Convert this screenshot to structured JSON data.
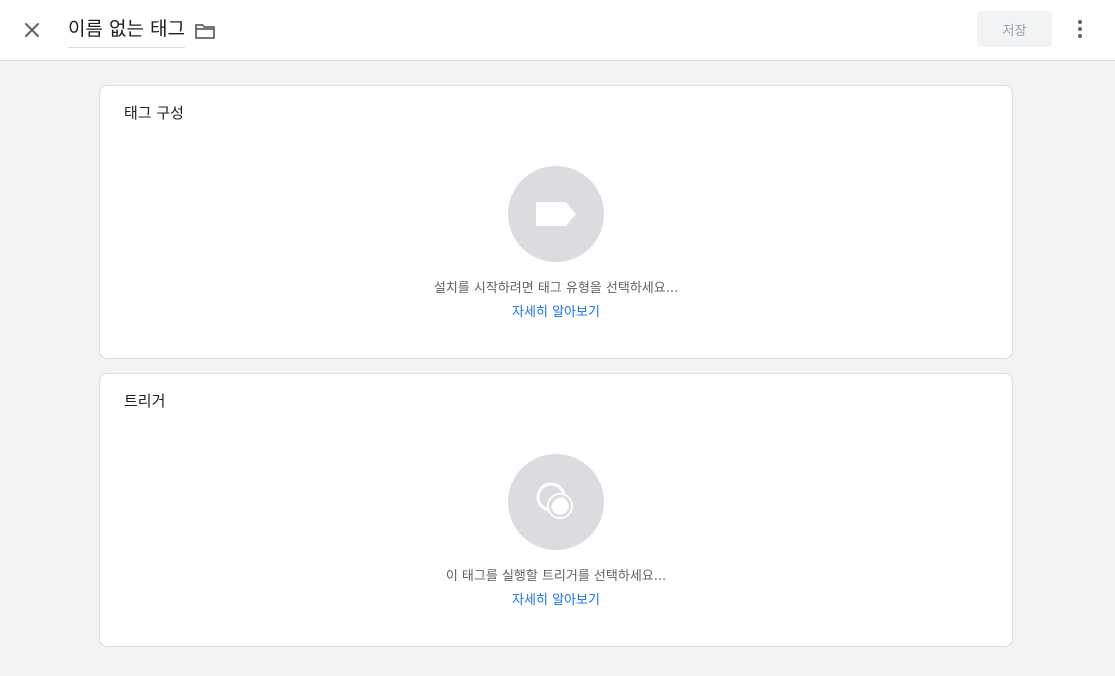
{
  "header": {
    "title": "이름 없는 태그",
    "save_label": "저장",
    "icons": {
      "close": "close-icon",
      "folder": "folder-icon",
      "more": "more-vert-icon"
    }
  },
  "tag_config": {
    "heading": "태그 구성",
    "icon": "tag-label-icon",
    "hint": "설치를 시작하려면 태그 유형을 선택하세요...",
    "link": "자세히 알아보기"
  },
  "triggers": {
    "heading": "트리거",
    "icon": "trigger-icon",
    "hint": "이 태그를 실행할 트리거를 선택하세요...",
    "link": "자세히 알아보기"
  },
  "colors": {
    "accent": "#1a73e8",
    "placeholder_circle": "#dadce0",
    "background": "#f1f3f4"
  }
}
